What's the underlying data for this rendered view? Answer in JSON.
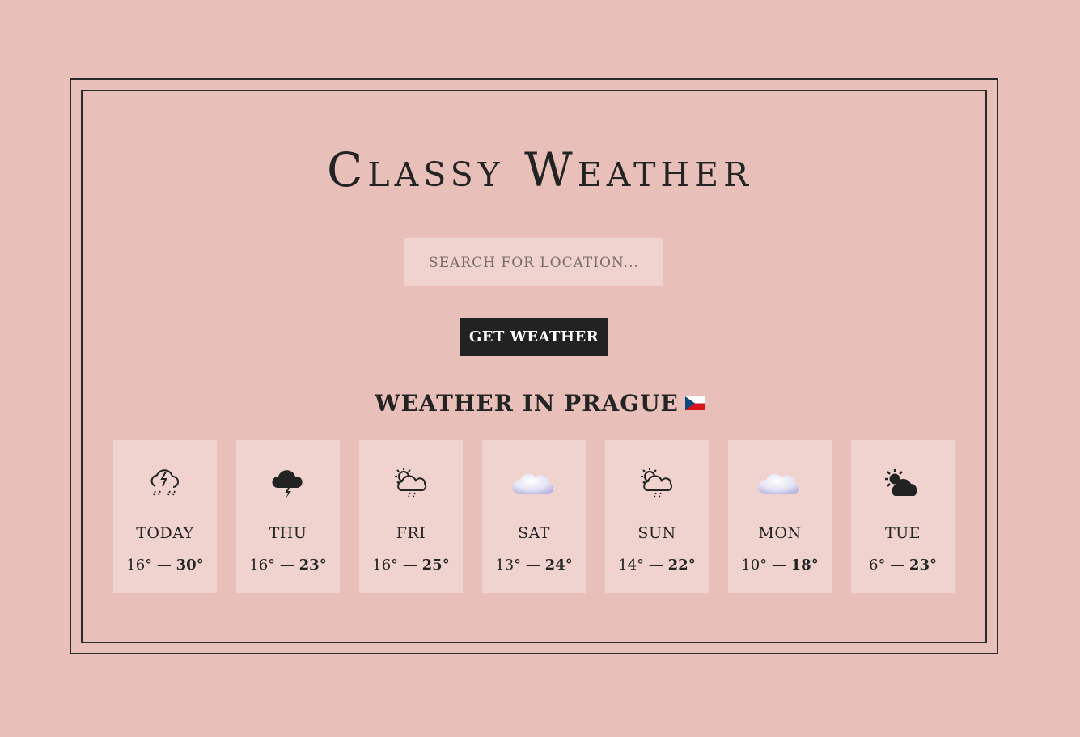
{
  "app": {
    "title": "Classy Weather"
  },
  "search": {
    "placeholder": "Search for location...",
    "value": ""
  },
  "button": {
    "label": "Get Weather"
  },
  "location": {
    "heading": "Weather in Prague",
    "flag_icon": "flag-czech-republic-icon"
  },
  "forecast": [
    {
      "day": "Today",
      "min": "16°",
      "max": "30°",
      "icon": "thunderstorm-rain-icon"
    },
    {
      "day": "Thu",
      "min": "16°",
      "max": "23°",
      "icon": "thunder-cloud-icon"
    },
    {
      "day": "Fri",
      "min": "16°",
      "max": "25°",
      "icon": "sun-cloud-rain-icon"
    },
    {
      "day": "Sat",
      "min": "13°",
      "max": "24°",
      "icon": "cloud-icon"
    },
    {
      "day": "Sun",
      "min": "14°",
      "max": "22°",
      "icon": "sun-cloud-rain-icon"
    },
    {
      "day": "Mon",
      "min": "10°",
      "max": "18°",
      "icon": "cloud-icon"
    },
    {
      "day": "Tue",
      "min": "6°",
      "max": "23°",
      "icon": "sun-behind-cloud-icon"
    }
  ],
  "separator": "—",
  "colors": {
    "background": "#e8bfb9",
    "card": "#f0d3cf",
    "text": "#242424",
    "button": "#222222"
  }
}
